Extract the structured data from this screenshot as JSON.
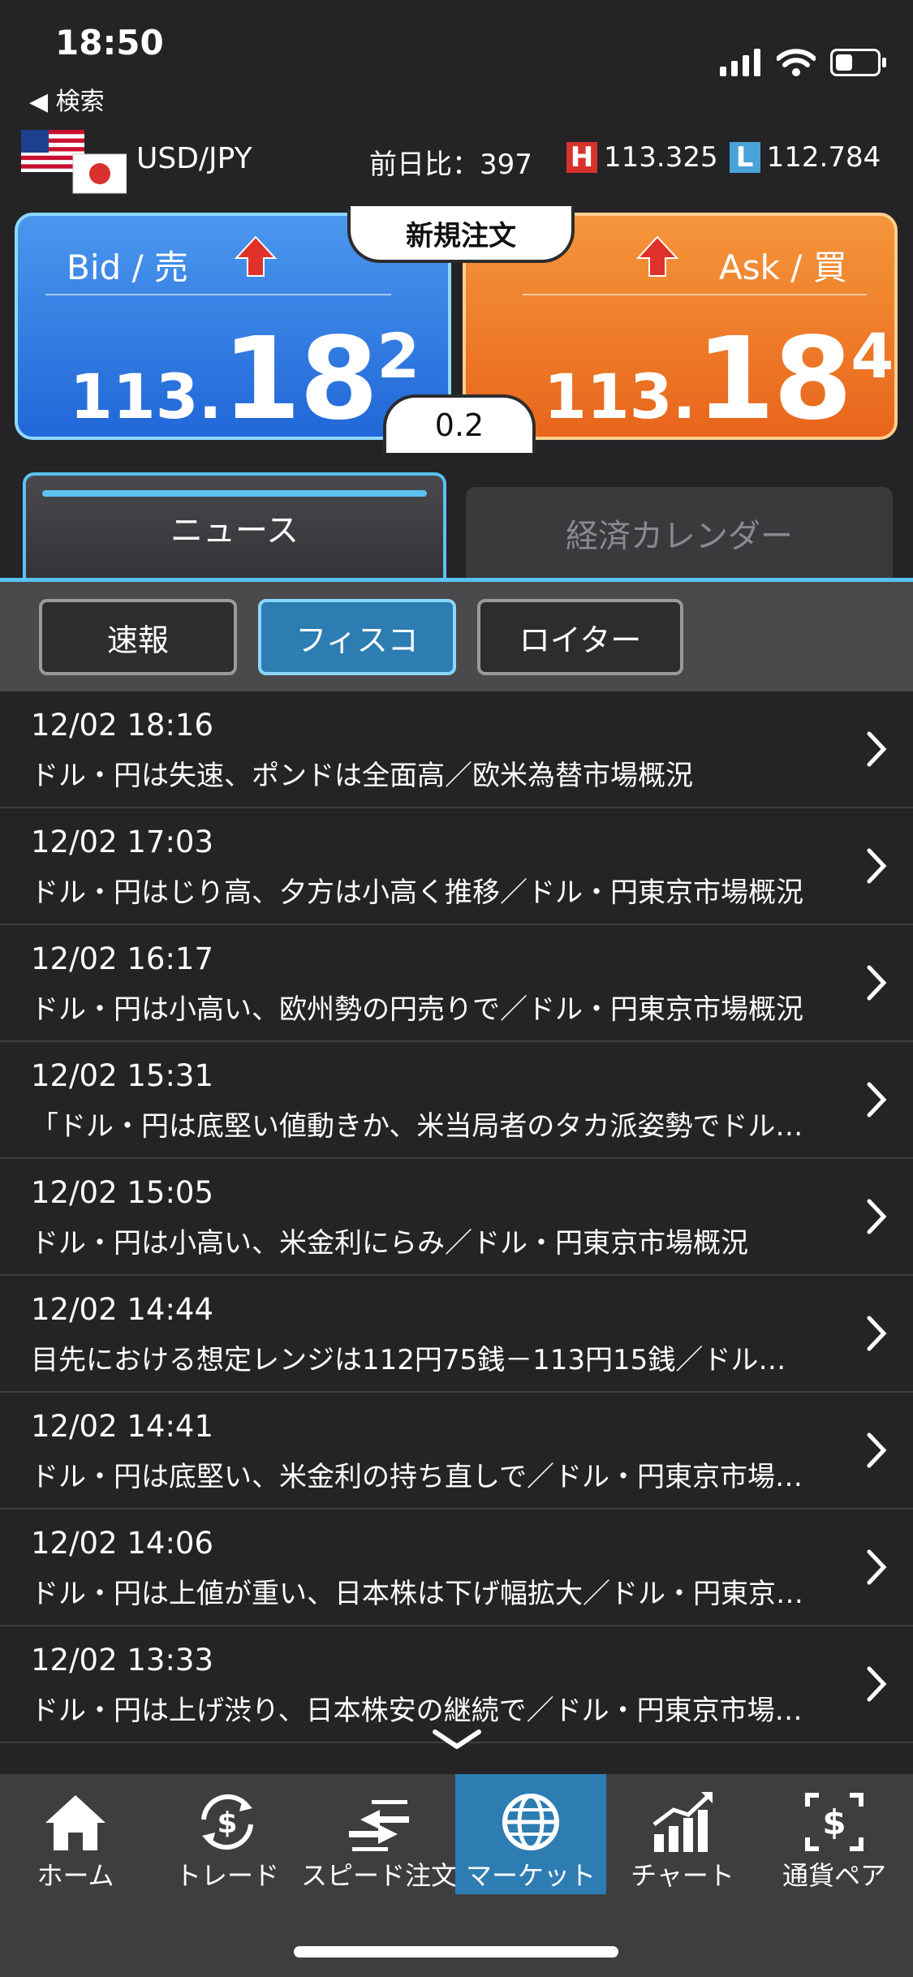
{
  "status_bar": {
    "time": "18:50",
    "back_label": "◀ 検索"
  },
  "header": {
    "pair": "USD/JPY",
    "change_label": "前日比：397",
    "high_badge": "H",
    "high_value": "113.325",
    "low_badge": "L",
    "low_value": "112.784"
  },
  "quote": {
    "bid_label": "Bid / 売",
    "bid_major": "113.",
    "bid_big": "18",
    "bid_pip": "2",
    "ask_label": "Ask / 買",
    "ask_major": "113.",
    "ask_big": "18",
    "ask_pip": "4",
    "new_order_label": "新規注文",
    "spread": "0.2"
  },
  "tabs": [
    {
      "label": "ニュース",
      "active": true
    },
    {
      "label": "経済カレンダー",
      "active": false
    }
  ],
  "filters": [
    {
      "label": "速報",
      "active": false
    },
    {
      "label": "フィスコ",
      "active": true
    },
    {
      "label": "ロイター",
      "active": false
    }
  ],
  "news": [
    {
      "time": "12/02 18:16",
      "title": "ドル・円は失速、ポンドは全面高／欧米為替市場概況"
    },
    {
      "time": "12/02 17:03",
      "title": "ドル・円はじり高、夕方は小高く推移／ドル・円東京市場概況"
    },
    {
      "time": "12/02 16:17",
      "title": "ドル・円は小高い、欧州勢の円売りで／ドル・円東京市場概況"
    },
    {
      "time": "12/02 15:31",
      "title": "「ドル・円は底堅い値動きか、米当局者のタカ派姿勢でドル…"
    },
    {
      "time": "12/02 15:05",
      "title": "ドル・円は小高い、米金利にらみ／ドル・円東京市場概況"
    },
    {
      "time": "12/02 14:44",
      "title": "目先における想定レンジは112円75銭－113円15銭／ドル…"
    },
    {
      "time": "12/02 14:41",
      "title": "ドル・円は底堅い、米金利の持ち直しで／ドル・円東京市場…"
    },
    {
      "time": "12/02 14:06",
      "title": "ドル・円は上値が重い、日本株は下げ幅拡大／ドル・円東京…"
    },
    {
      "time": "12/02 13:33",
      "title": "ドル・円は上げ渋り、日本株安の継続で／ドル・円東京市場…"
    }
  ],
  "nav": [
    {
      "label": "ホーム",
      "icon": "home-icon",
      "active": false
    },
    {
      "label": "トレード",
      "icon": "trade-icon",
      "active": false
    },
    {
      "label": "スピード注文",
      "icon": "speed-order-icon",
      "active": false
    },
    {
      "label": "マーケット",
      "icon": "globe-icon",
      "active": true
    },
    {
      "label": "チャート",
      "icon": "chart-icon",
      "active": false
    },
    {
      "label": "通貨ペア",
      "icon": "currency-pair-icon",
      "active": false
    }
  ],
  "colors": {
    "accent": "#5bc2f0",
    "bid": "#2f78e0",
    "ask": "#ee7a25",
    "high_badge": "#d8322c",
    "low_badge": "#4aa3d8"
  }
}
